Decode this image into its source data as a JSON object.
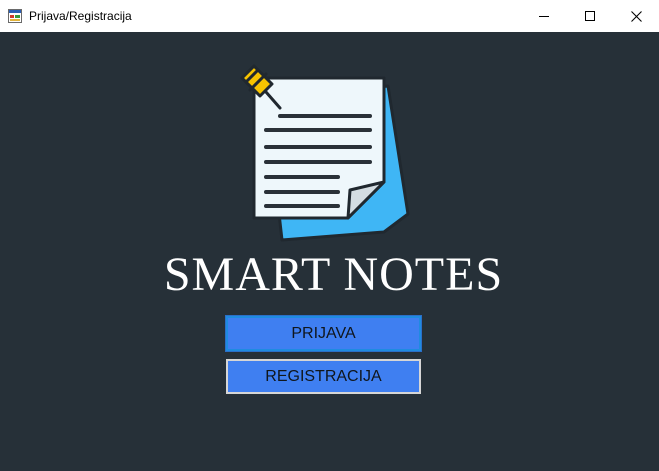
{
  "window": {
    "title": "Prijava/Registracija",
    "icons": {
      "app": "form-app-icon",
      "minimize": "minimize-icon",
      "maximize": "maximize-icon",
      "close": "close-icon"
    }
  },
  "main": {
    "logo_icon": "pinned-note-icon",
    "heading": "SMART NOTES",
    "login_label": "PRIJAVA",
    "register_label": "REGISTRACIJA"
  },
  "colors": {
    "background": "#263038",
    "button": "#3f7ff1",
    "note_accent": "#3fb6f5",
    "pin": "#f7c400"
  }
}
